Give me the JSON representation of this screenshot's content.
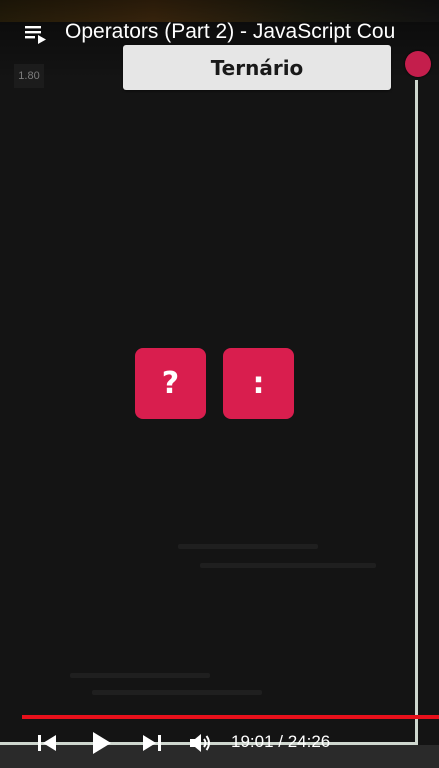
{
  "video": {
    "title": "Operators (Part 2) - JavaScript Cou",
    "playback_speed": "1.80"
  },
  "slide": {
    "heading": "Ternário",
    "operators": [
      "?",
      ":"
    ]
  },
  "player": {
    "current_time": "19:01",
    "duration": "24:26",
    "time_label": "19:01 / 24:26",
    "progress_color": "#e8101b",
    "tile_color": "#d91e4e"
  },
  "icons": {
    "playlist": "playlist-icon",
    "previous": "skip-previous-icon",
    "play": "play-icon",
    "next": "skip-next-icon",
    "volume": "volume-icon"
  }
}
